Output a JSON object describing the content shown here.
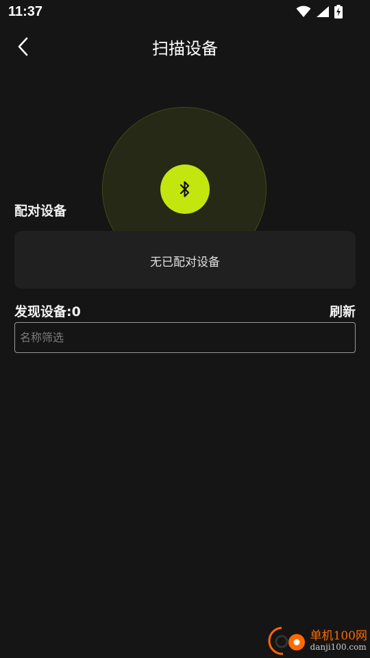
{
  "status_bar": {
    "time": "11:37",
    "icons": [
      "wifi-icon",
      "signal-icon",
      "battery-charging-icon"
    ]
  },
  "header": {
    "back_icon": "chevron-left-icon",
    "title": "扫描设备"
  },
  "scanner": {
    "icon": "bluetooth-icon",
    "accent_color": "#c3e60e"
  },
  "paired": {
    "label": "配对设备",
    "empty_text": "无已配对设备"
  },
  "discovered": {
    "label": "发现设备:0",
    "refresh_label": "刷新"
  },
  "filter": {
    "placeholder": "名称筛选",
    "value": ""
  },
  "watermark": {
    "title": "单机100网",
    "url": "danji100.com"
  },
  "colors": {
    "background": "#151515",
    "card": "#202020",
    "accent": "#c3e60e",
    "watermark_orange": "#ff6a00"
  }
}
